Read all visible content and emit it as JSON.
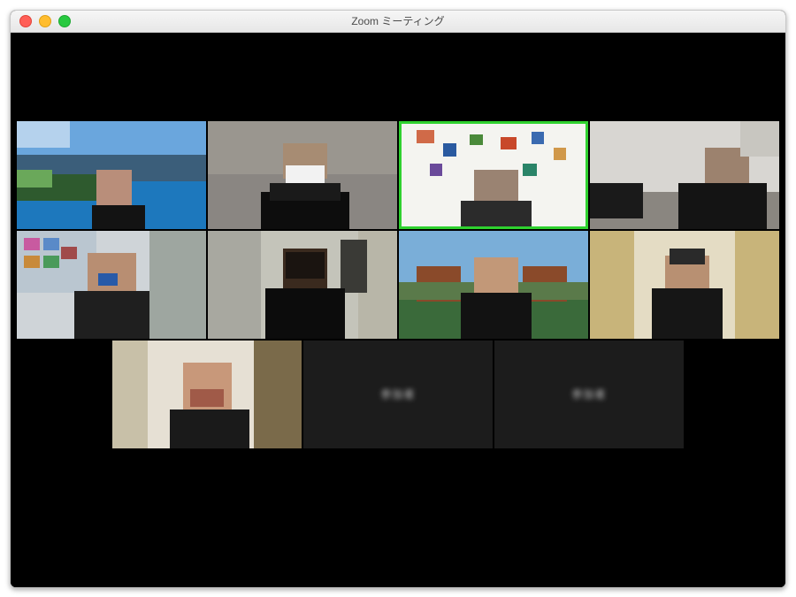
{
  "window": {
    "title": "Zoom ミーティング"
  },
  "participants": [
    {
      "id": "p1",
      "camera": true,
      "name": ""
    },
    {
      "id": "p2",
      "camera": true,
      "name": ""
    },
    {
      "id": "p3",
      "camera": true,
      "name": ""
    },
    {
      "id": "p4",
      "camera": true,
      "name": ""
    },
    {
      "id": "p5",
      "camera": true,
      "name": ""
    },
    {
      "id": "p6",
      "camera": true,
      "name": ""
    },
    {
      "id": "p7",
      "camera": true,
      "name": ""
    },
    {
      "id": "p8",
      "camera": true,
      "name": ""
    },
    {
      "id": "p9",
      "camera": true,
      "name": ""
    },
    {
      "id": "p10",
      "camera": false,
      "name": "参加者"
    },
    {
      "id": "p11",
      "camera": false,
      "name": "参加者"
    }
  ],
  "colors": {
    "window_bg": "#000000",
    "titlebar_text": "#4a4a4a",
    "camoff_bg": "#1c1c1c",
    "accent_green": "#2fd12f"
  }
}
